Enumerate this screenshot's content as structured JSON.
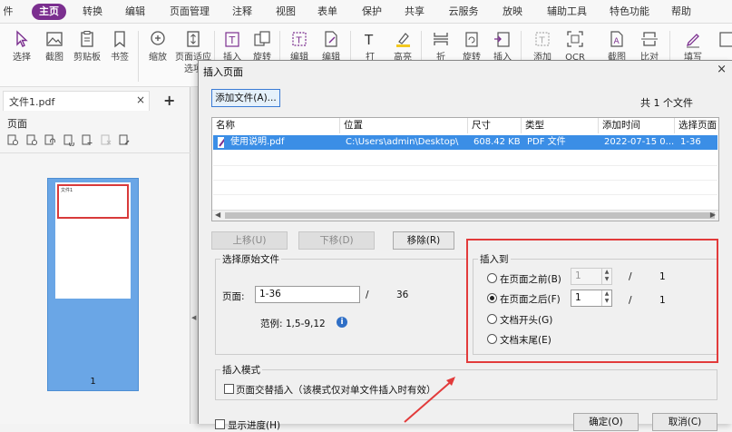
{
  "menu": {
    "items": [
      "件",
      "主页",
      "转换",
      "编辑",
      "页面管理",
      "注释",
      "视图",
      "表单",
      "保护",
      "共享",
      "云服务",
      "放映",
      "辅助工具",
      "特色功能",
      "帮助"
    ],
    "active": "主页"
  },
  "ribbon": {
    "buttons": [
      "选择",
      "截图",
      "剪贴板",
      "书签",
      "缩放",
      "页面适应选项",
      "插入",
      "旋转",
      "编辑",
      "编辑",
      "打",
      "高亮",
      "折",
      "旋转",
      "插入",
      "添加",
      "OCR",
      "截图",
      "比对",
      "填写",
      ""
    ]
  },
  "left_panel": {
    "tab_label": "文件1.pdf",
    "close_glyph": "×",
    "add_glyph": "+",
    "section_title": "页面",
    "thumb_title": "文件1",
    "page_number": "1"
  },
  "dialog": {
    "title": "插入页面",
    "close_glyph": "×",
    "add_file_label": "添加文件(A)...",
    "total_label": "共 1 个文件",
    "columns": [
      "名称",
      "位置",
      "尺寸",
      "类型",
      "添加时间",
      "选择页面"
    ],
    "rows": [
      {
        "name": "使用说明.pdf",
        "location": "C:\\Users\\admin\\Desktop\\",
        "size": "608.42 KB",
        "type": "PDF 文件",
        "added": "2022-07-15 0...",
        "pages": "1-36"
      }
    ],
    "move_up_label": "上移(U)",
    "move_down_label": "下移(D)",
    "remove_label": "移除(R)",
    "source": {
      "group_label": "选择原始文件",
      "pages_label": "页面:",
      "pages_value": "1-36",
      "slash": "/",
      "total_pages": "36",
      "example_label": "范例: 1,5-9,12",
      "info_glyph": "i"
    },
    "insert_to": {
      "group_label": "插入到",
      "options": [
        "在页面之前(B)",
        "在页面之后(F)",
        "文档开头(G)",
        "文档末尾(E)"
      ],
      "selected": "在页面之后(F)",
      "before_page": "1",
      "after_page": "1",
      "slash": "/",
      "total": "1"
    },
    "mode": {
      "group_label": "插入模式",
      "alternate_label": "页面交替插入（该模式仅对单文件插入时有效）"
    },
    "show_progress_label": "显示进度(H)",
    "ok_label": "确定(O)",
    "cancel_label": "取消(C)"
  },
  "colors": {
    "brand": "#7b2f8f",
    "selection": "#3b8ee6",
    "highlight": "#e23b3b"
  }
}
